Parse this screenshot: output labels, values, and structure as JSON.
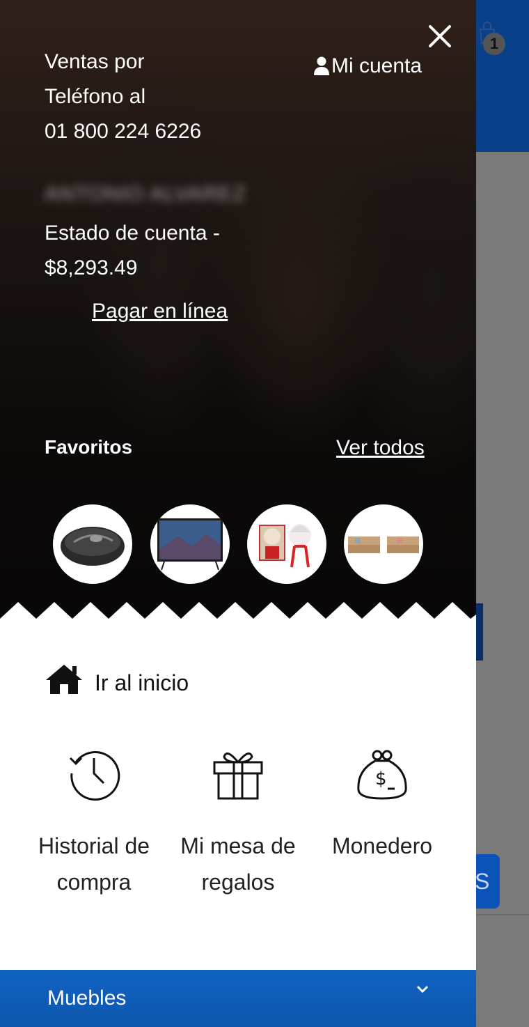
{
  "background_page": {
    "cart_count": "1",
    "button_fragment": "S"
  },
  "drawer": {
    "account_link": "Mi cuenta",
    "phone_line1": "Ventas por",
    "phone_line2": "Teléfono al",
    "phone_number": "01 800 224 6226",
    "user_name": "ANTONIO ALVAREZ",
    "estado_line1": "Estado de cuenta -",
    "estado_amount": "$8,293.49",
    "pagar_link": "Pagar en línea",
    "favorites_title": "Favoritos",
    "favorites_see_all": "Ver todos",
    "favorites": [
      {
        "name": "wireless-mouse-thumbnail"
      },
      {
        "name": "television-thumbnail"
      },
      {
        "name": "funko-pop-thumbnail"
      },
      {
        "name": "sofa-thumbnail"
      }
    ],
    "home_label": "Ir al inicio",
    "quick_links": [
      {
        "icon": "history-icon",
        "line1": "Historial de",
        "line2": "compra"
      },
      {
        "icon": "gift-icon",
        "line1": "Mi mesa de",
        "line2": "regalos"
      },
      {
        "icon": "money-bag-icon",
        "line1": "Monedero",
        "line2": ""
      }
    ],
    "category": "Muebles",
    "colors": {
      "brand_blue": "#0d56ad",
      "header_blue": "#0a3f8a",
      "hero_dark": "#151110"
    }
  }
}
